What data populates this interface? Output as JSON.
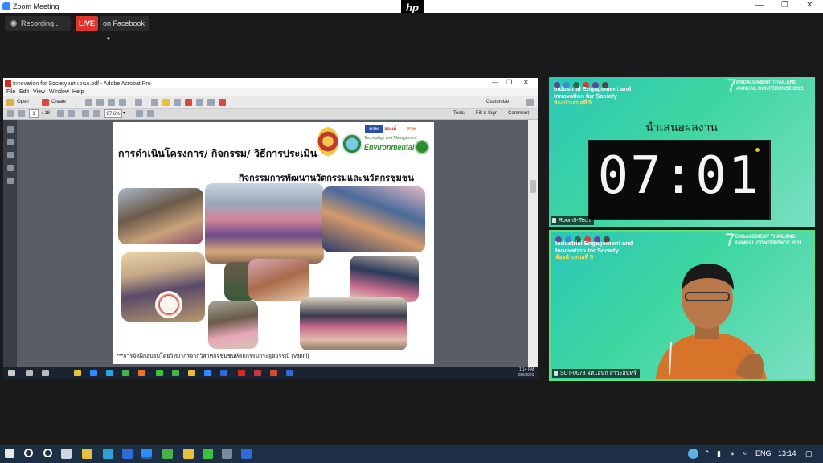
{
  "zoom": {
    "window_title": "Zoom Meeting",
    "hp_logo": "hp",
    "recording_label": "Recording...",
    "live_badge": "LIVE",
    "live_target": "on Facebook"
  },
  "acrobat": {
    "window_title": "Innovation for Society ผศ.เอนก.pdf - Adobe Acrobat Pro",
    "menu": [
      "File",
      "Edit",
      "View",
      "Window",
      "Help"
    ],
    "toolbar": {
      "open_label": "Open",
      "create_label": "Create",
      "customize_label": "Customize",
      "page_current": "1",
      "page_total": "/ 18",
      "zoom_level": "87.6%",
      "tools_label": "Tools",
      "fill_sign_label": "Fill & Sign",
      "comment_label": "Comment"
    }
  },
  "slide": {
    "title": "การดำเนินโครงการ/ กิจกรรม/ วิธีการประเมิน",
    "subtitle": "กิจกรรมการพัฒนานวัตกรรมและนวัตกรชุมชน",
    "footnote": "***การจัดฝึกอบรมโดยวิทยากรจากวิสาหกิจชุมชนหัตถกรรมกระจูดวรรณี (Vanni)",
    "env_logo_text": "Environmental",
    "top_logos": [
      "มจพ",
      "ฮอนด์",
      "ศวท"
    ]
  },
  "inner_taskbar": {
    "time": "1:14 PM",
    "date": "9/3/2021"
  },
  "tiles": {
    "header_line1": "Industrial Engagement and",
    "header_line2": "Innovation for Society",
    "header_sub": "ห้องนำเสนอที่ 5",
    "conf_number": "7",
    "conf_line1": "ENGAGEMENT THAILAND",
    "conf_line2": "ANNUAL CONFERENCE 2021",
    "timer_label": "นำเสนอผลงาน",
    "timer_value": "07:01",
    "room_name": "Room5-Tech",
    "speaker_name": "SUT-0073 ผศ.เอนก สาวะอินทร์"
  },
  "system_tray": {
    "language": "ENG",
    "time": "13:14"
  },
  "colors": {
    "live_red": "#e0332e",
    "tile_teal": "#2cc7b7",
    "taskbar": "#1c2f45"
  }
}
